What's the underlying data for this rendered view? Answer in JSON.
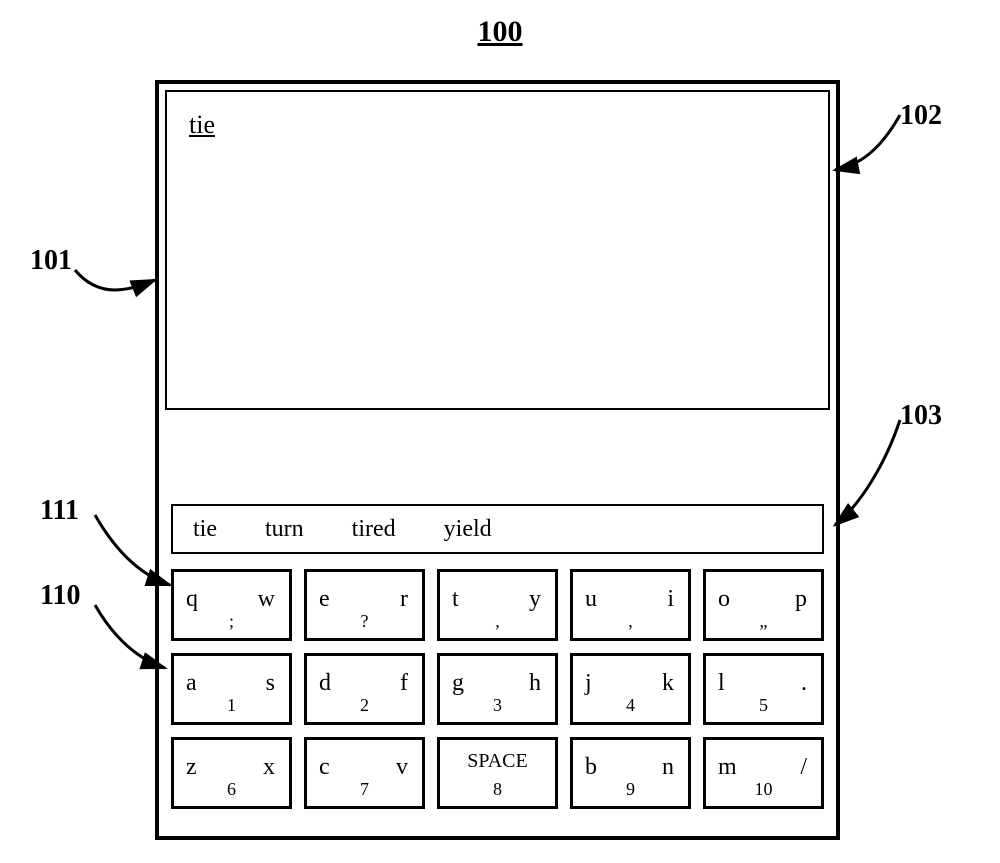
{
  "figure_number": "100",
  "callouts": {
    "c101": "101",
    "c102": "102",
    "c103": "103",
    "c110": "110",
    "c111": "111"
  },
  "typed": "tie",
  "suggestions": [
    "tie",
    "turn",
    "tired",
    "yield"
  ],
  "keys": [
    [
      {
        "l": "q",
        "r": "w",
        "sub": ";"
      },
      {
        "l": "e",
        "r": "r",
        "sub": "?"
      },
      {
        "l": "t",
        "r": "y",
        "sub": ","
      },
      {
        "l": "u",
        "r": "i",
        "sub": ","
      },
      {
        "l": "o",
        "r": "p",
        "sub": "„"
      }
    ],
    [
      {
        "l": "a",
        "r": "s",
        "sub": "1"
      },
      {
        "l": "d",
        "r": "f",
        "sub": "2"
      },
      {
        "l": "g",
        "r": "h",
        "sub": "3"
      },
      {
        "l": "j",
        "r": "k",
        "sub": "4"
      },
      {
        "l": "l",
        "r": ".",
        "sub": "5"
      }
    ],
    [
      {
        "l": "z",
        "r": "x",
        "sub": "6"
      },
      {
        "l": "c",
        "r": "v",
        "sub": "7"
      },
      {
        "center": "SPACE",
        "sub": "8"
      },
      {
        "l": "b",
        "r": "n",
        "sub": "9"
      },
      {
        "l": "m",
        "r": "/",
        "sub": "10"
      }
    ]
  ]
}
